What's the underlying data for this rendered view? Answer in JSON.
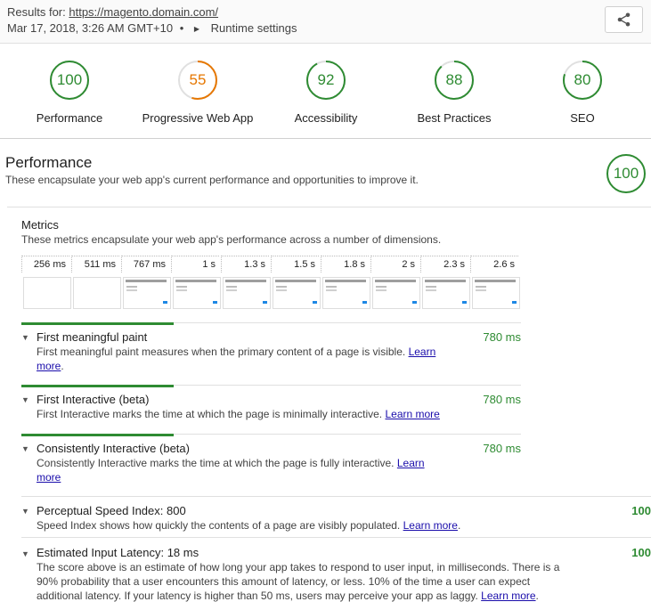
{
  "header": {
    "results_prefix": "Results for:",
    "url": "https://magento.domain.com/",
    "timestamp": "Mar 17, 2018, 3:26 AM GMT+10",
    "bullet": "•",
    "runtime_settings": "Runtime settings"
  },
  "gauges": [
    {
      "label": "Performance",
      "score": "100",
      "value": 100,
      "status": "pass"
    },
    {
      "label": "Progressive Web App",
      "score": "55",
      "value": 55,
      "status": "average"
    },
    {
      "label": "Accessibility",
      "score": "92",
      "value": 92,
      "status": "pass"
    },
    {
      "label": "Best Practices",
      "score": "88",
      "value": 88,
      "status": "pass"
    },
    {
      "label": "SEO",
      "score": "80",
      "value": 80,
      "status": "pass"
    }
  ],
  "colors": {
    "pass": "#2e8b32",
    "average": "#e67700",
    "ring_bg": "#e0e0e0"
  },
  "performance": {
    "title": "Performance",
    "description": "These encapsulate your web app's current performance and opportunities to improve it.",
    "score": "100"
  },
  "metrics": {
    "title": "Metrics",
    "description": "These metrics encapsulate your web app's performance across a number of dimensions.",
    "filmstrip": [
      "256 ms",
      "511 ms",
      "767 ms",
      "1 s",
      "1.3 s",
      "1.5 s",
      "1.8 s",
      "2 s",
      "2.3 s",
      "2.6 s"
    ]
  },
  "audits": {
    "fmp": {
      "name": "First meaningful paint",
      "value": "780 ms",
      "text": "First meaningful paint measures when the primary content of a page is visible.",
      "learn_1": "Learn",
      "learn_2": "more"
    },
    "fi": {
      "name": "First Interactive (beta)",
      "value": "780 ms",
      "text": "First Interactive marks the time at which the page is minimally interactive.",
      "learn": "Learn more"
    },
    "ci": {
      "name": "Consistently Interactive (beta)",
      "value": "780 ms",
      "text": "Consistently Interactive marks the time at which the page is fully interactive.",
      "learn_1": "Learn",
      "learn_2": "more"
    },
    "psi": {
      "name": "Perceptual Speed Index: 800",
      "value": "100",
      "text": "Speed Index shows how quickly the contents of a page are visibly populated.",
      "learn": "Learn more"
    },
    "eil": {
      "name": "Estimated Input Latency: 18 ms",
      "value": "100",
      "line1": "The score above is an estimate of how long your app takes to respond to user input, in milliseconds. There is a",
      "line2": "90% probability that a user encounters this amount of latency, or less. 10% of the time a user can expect",
      "line3": "additional latency. If your latency is higher than 50 ms, users may perceive your app as laggy.",
      "learn": "Learn more"
    }
  }
}
